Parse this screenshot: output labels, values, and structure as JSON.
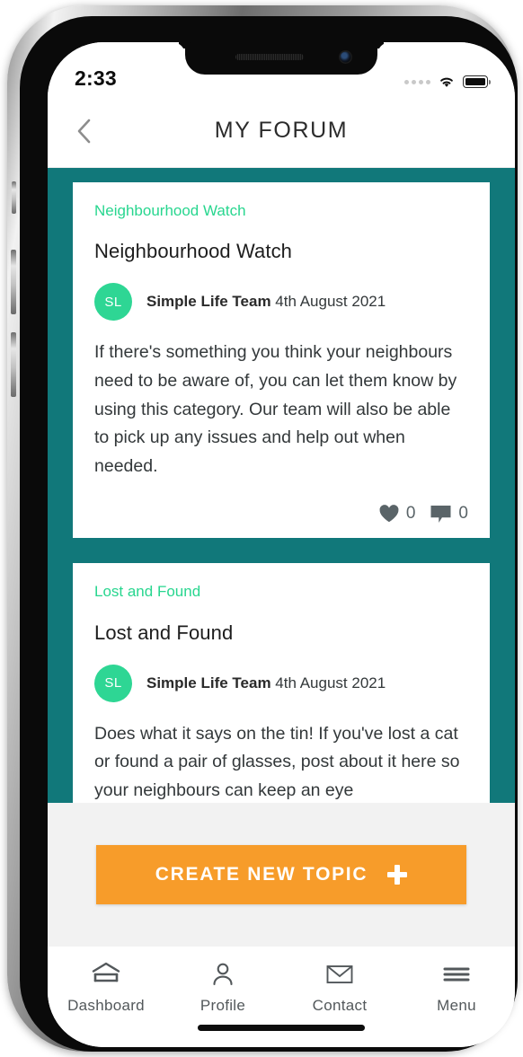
{
  "status_bar": {
    "time": "2:33",
    "signal_icon": "signal-dots-icon",
    "wifi_icon": "wifi-icon",
    "battery_icon": "battery-full-icon"
  },
  "navbar": {
    "back_icon": "chevron-left-icon",
    "title": "MY FORUM"
  },
  "theme": {
    "background_teal": "#11787a",
    "category_green": "#28d68f",
    "avatar_green": "#2ed694",
    "cta_orange": "#f79c2a",
    "footer_gray": "#f2f2f2",
    "body_text": "#33383a"
  },
  "posts": [
    {
      "category": "Neighbourhood Watch",
      "title": "Neighbourhood Watch",
      "avatar_initials": "SL",
      "author": "Simple Life Team",
      "date": "4th August 2021",
      "body": "If there's something you think your neighbours need to be aware of, you can let them know by using this category. Our team will also be able to pick up any issues and help out when needed.",
      "likes": "0",
      "comments": "0",
      "like_icon": "heart-icon",
      "comment_icon": "comment-bubble-icon"
    },
    {
      "category": "Lost and Found",
      "title": "Lost and Found",
      "avatar_initials": "SL",
      "author": "Simple Life Team",
      "date": "4th August 2021",
      "body": "Does what it says on the tin! If you've lost a cat or found a pair of glasses, post about it here so your neighbours can keep an eye"
    }
  ],
  "cta": {
    "label": "CREATE NEW TOPIC",
    "icon": "plus-icon"
  },
  "tabbar": [
    {
      "label": "Dashboard",
      "icon": "dashboard-house-icon"
    },
    {
      "label": "Profile",
      "icon": "person-icon"
    },
    {
      "label": "Contact",
      "icon": "envelope-icon"
    },
    {
      "label": "Menu",
      "icon": "hamburger-menu-icon"
    }
  ]
}
